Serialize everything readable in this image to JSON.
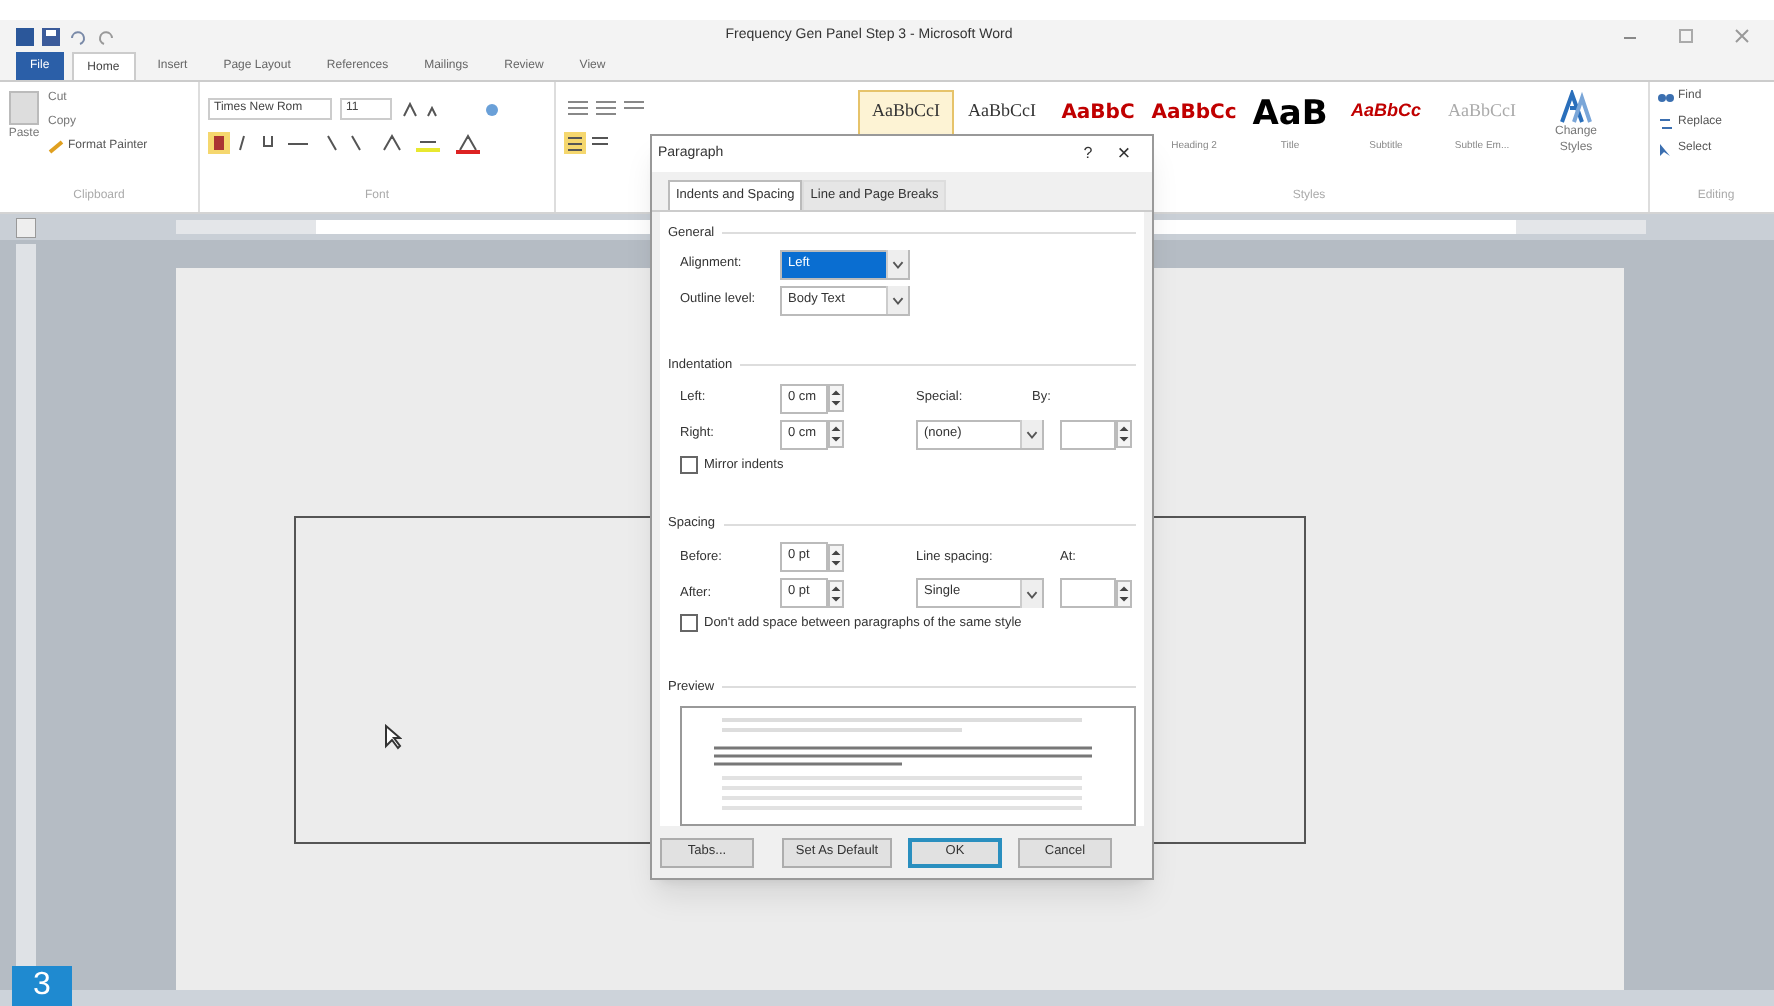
{
  "window": {
    "title": "Frequency Gen Panel Step 3 - Microsoft Word"
  },
  "ribbon_tabs": [
    {
      "label": "File",
      "kind": "file",
      "selected": false
    },
    {
      "label": "Home",
      "kind": "tab",
      "selected": true
    },
    {
      "label": "Insert",
      "kind": "tab",
      "selected": false
    },
    {
      "label": "Page Layout",
      "kind": "tab",
      "selected": false
    },
    {
      "label": "References",
      "kind": "tab",
      "selected": false
    },
    {
      "label": "Mailings",
      "kind": "tab",
      "selected": false
    },
    {
      "label": "Review",
      "kind": "tab",
      "selected": false
    },
    {
      "label": "View",
      "kind": "tab",
      "selected": false
    }
  ],
  "clipboard": {
    "paste": "Paste",
    "cut": "Cut",
    "copy": "Copy",
    "format_painter": "Format Painter",
    "label": "Clipboard"
  },
  "font": {
    "name": "Times New Rom",
    "size": "11",
    "label": "Font"
  },
  "styles": {
    "label": "Styles",
    "items": [
      {
        "preview": "AaBbCcI",
        "kind": "normal",
        "selected": true
      },
      {
        "preview": "AaBbCcI",
        "kind": "normal",
        "selected": false
      },
      {
        "preview": "AaBbC",
        "kind": "red",
        "selected": false
      },
      {
        "preview": "AaBbCc",
        "kind": "red",
        "name": "Heading 2",
        "selected": false
      },
      {
        "preview": "AaB",
        "kind": "title",
        "name": "Title",
        "selected": false
      },
      {
        "preview": "AaBbCc",
        "kind": "italic",
        "name": "Subtitle",
        "selected": false
      },
      {
        "preview": "AaBbCcI",
        "kind": "faint",
        "name": "Subtle Em...",
        "selected": false
      }
    ],
    "change_styles": "Change Styles"
  },
  "editing": {
    "find": "Find",
    "replace": "Replace",
    "select": "Select",
    "label": "Editing"
  },
  "dialog": {
    "title": "Paragraph",
    "help": "?",
    "close": "×",
    "tabs": [
      {
        "label": "Indents and Spacing",
        "selected": true
      },
      {
        "label": "Line and Page Breaks",
        "selected": false
      }
    ],
    "general": {
      "heading": "General",
      "alignment_label": "Alignment:",
      "alignment": "Left",
      "outline_label": "Outline level:",
      "outline": "Body Text"
    },
    "indentation": {
      "heading": "Indentation",
      "left_label": "Left:",
      "left": "0 cm",
      "right_label": "Right:",
      "right": "0 cm",
      "special_label": "Special:",
      "special": "(none)",
      "by_label": "By:",
      "mirror": {
        "label": "Mirror indents",
        "checked": false
      }
    },
    "spacing": {
      "heading": "Spacing",
      "before_label": "Before:",
      "before": "0 pt",
      "after_label": "After:",
      "after": "0 pt",
      "line_label": "Line spacing:",
      "line": "Single",
      "at_label": "At:",
      "no_space": {
        "label": "Don't add space between paragraphs of the same style",
        "checked": false
      }
    },
    "preview_heading": "Preview",
    "buttons": [
      {
        "label": "Tabs...",
        "default": false
      },
      {
        "label": "Set As Default",
        "default": false
      },
      {
        "label": "OK",
        "default": true
      },
      {
        "label": "Cancel",
        "default": false
      }
    ]
  },
  "step_badge": "3"
}
